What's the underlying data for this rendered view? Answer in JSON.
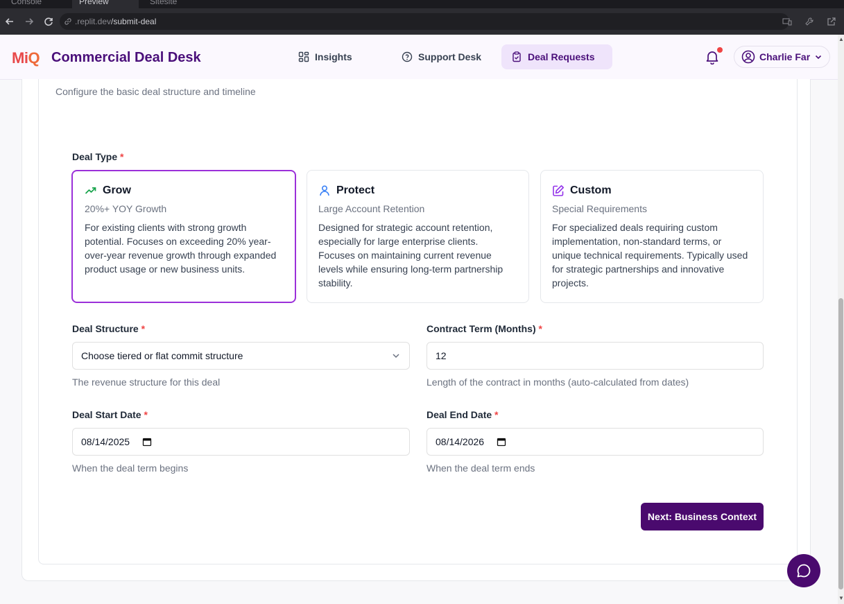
{
  "browser": {
    "tabs": [
      "Console",
      "Preview",
      "Sitesite"
    ],
    "url_prefix": ".replit.dev",
    "url_path": "/submit-deal"
  },
  "header": {
    "logo": "MiQ",
    "title": "Commercial Deal Desk",
    "nav": [
      {
        "label": "Insights",
        "icon": "grid-icon"
      },
      {
        "label": "Support Desk",
        "icon": "help-circle-icon"
      },
      {
        "label": "Deal Requests",
        "icon": "clipboard-icon"
      }
    ],
    "active_nav": "Deal Requests",
    "user_name": "Charlie Far"
  },
  "form": {
    "subtitle": "Configure the basic deal structure and timeline",
    "deal_type_label": "Deal Type",
    "required_mark": "*",
    "deal_types": [
      {
        "name": "Grow",
        "icon": "trending-up-icon",
        "subtitle": "20%+ YOY Growth",
        "description": "For existing clients with strong growth potential. Focuses on exceeding 20% year-over-year revenue growth through expanded product usage or new business units.",
        "selected": true
      },
      {
        "name": "Protect",
        "icon": "user-icon",
        "subtitle": "Large Account Retention",
        "description": "Designed for strategic account retention, especially for large enterprise clients. Focuses on maintaining current revenue levels while ensuring long-term partnership stability.",
        "selected": false
      },
      {
        "name": "Custom",
        "icon": "edit-icon",
        "subtitle": "Special Requirements",
        "description": "For specialized deals requiring custom implementation, non-standard terms, or unique technical requirements. Typically used for strategic partnerships and innovative projects.",
        "selected": false
      }
    ],
    "deal_structure": {
      "label": "Deal Structure",
      "placeholder": "Choose tiered or flat commit structure",
      "hint": "The revenue structure for this deal"
    },
    "contract_term": {
      "label": "Contract Term (Months)",
      "value": "12",
      "hint": "Length of the contract in months (auto-calculated from dates)"
    },
    "start_date": {
      "label": "Deal Start Date",
      "value": "08/14/2025",
      "hint": "When the deal term begins"
    },
    "end_date": {
      "label": "Deal End Date",
      "value": "08/14/2026",
      "hint": "When the deal term ends"
    },
    "next_button": "Next: Business Context"
  },
  "colors": {
    "brand": "#4a0a6e",
    "selected_border": "#9b30d9",
    "grow_icon": "#16a34a",
    "protect_icon": "#3b82f6",
    "custom_icon": "#9333ea",
    "required": "#ef4444"
  }
}
